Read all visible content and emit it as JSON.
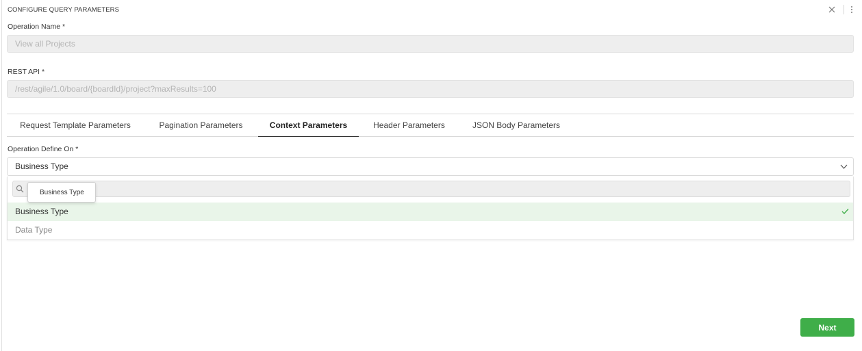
{
  "dialog": {
    "title": "CONFIGURE QUERY PARAMETERS"
  },
  "operation_name": {
    "label": "Operation Name *",
    "value": "View all Projects"
  },
  "rest_api": {
    "label": "REST API *",
    "value": "/rest/agile/1.0/board/{boardId}/project?maxResults=100"
  },
  "tabs": [
    {
      "label": "Request Template Parameters",
      "active": false
    },
    {
      "label": "Pagination Parameters",
      "active": false
    },
    {
      "label": "Context Parameters",
      "active": true
    },
    {
      "label": "Header Parameters",
      "active": false
    },
    {
      "label": "JSON Body Parameters",
      "active": false
    }
  ],
  "operation_define_on": {
    "label": "Operation Define On *",
    "selected": "Business Type",
    "search_placeholder": "Search",
    "options": [
      {
        "label": "Business Type",
        "selected": true
      },
      {
        "label": "Data Type",
        "selected": false
      }
    ],
    "tooltip": "Business Type"
  },
  "footer": {
    "next_label": "Next"
  },
  "colors": {
    "accent_green": "#3fae49",
    "selected_row": "#e9f5e9",
    "readonly_field": "#eeeeee"
  }
}
